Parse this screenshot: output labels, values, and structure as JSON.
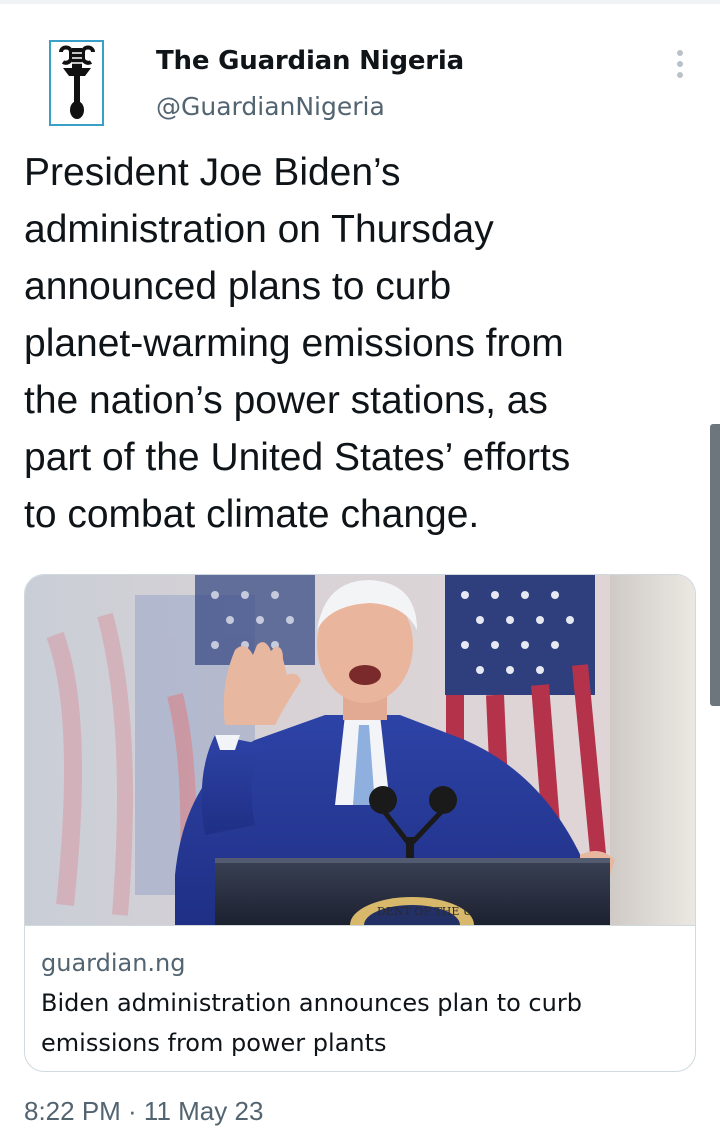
{
  "tweet": {
    "author": {
      "display_name": "The Guardian Nigeria",
      "handle": "@GuardianNigeria",
      "avatar_icon": "guardian-nigeria-logo"
    },
    "more_icon": "more-options-icon",
    "text": "President Joe Biden’s\nadministration on Thursday\nannounced plans to curb\nplanet-warming emissions from\nthe nation’s power stations, as\npart of the United States’ efforts\nto combat climate change.",
    "link_card": {
      "image_description": "photo",
      "domain": "guardian.ng",
      "title": "Biden administration announces plan to curb emissions from power plants",
      "seal_text": "DENT OF THE U"
    },
    "timestamp": "8:22 PM · 11 May 23"
  },
  "colors": {
    "text_primary": "#0f1419",
    "text_secondary": "#536471",
    "border": "#cfd9de",
    "logo_border": "#3aa0c8",
    "suit_blue": "#24389a",
    "flag_red": "#b5334a"
  }
}
